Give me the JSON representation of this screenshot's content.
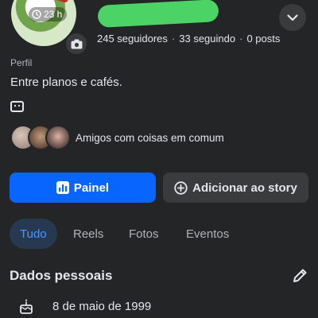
{
  "profile": {
    "story_time": "23 h",
    "stats": {
      "followers": "245 seguidores",
      "following": "33 seguindo",
      "posts": "0 posts",
      "separator": "·"
    },
    "name_blob_color": "#4bd365"
  },
  "about": {
    "section_label": "Perfil",
    "bio": "Entre planos e cafés.",
    "mutual_friends_text": "Amigos com coisas em comum"
  },
  "actions": {
    "dashboard_label": "Painel",
    "add_story_label": "Adicionar ao story"
  },
  "tabs": [
    {
      "label": "Tudo",
      "active": true
    },
    {
      "label": "Reels",
      "active": false
    },
    {
      "label": "Fotos",
      "active": false
    },
    {
      "label": "Eventos",
      "active": false
    }
  ],
  "personal_details": {
    "heading": "Dados pessoais",
    "birthday": "8 de maio de 1999",
    "birthday_icon": "cake-icon"
  },
  "colors": {
    "background": "#242526",
    "primary": "#0866ff",
    "secondary_button": "#3a3b3c",
    "active_tab_bg": "#263951",
    "active_tab_text": "#4599ff"
  }
}
